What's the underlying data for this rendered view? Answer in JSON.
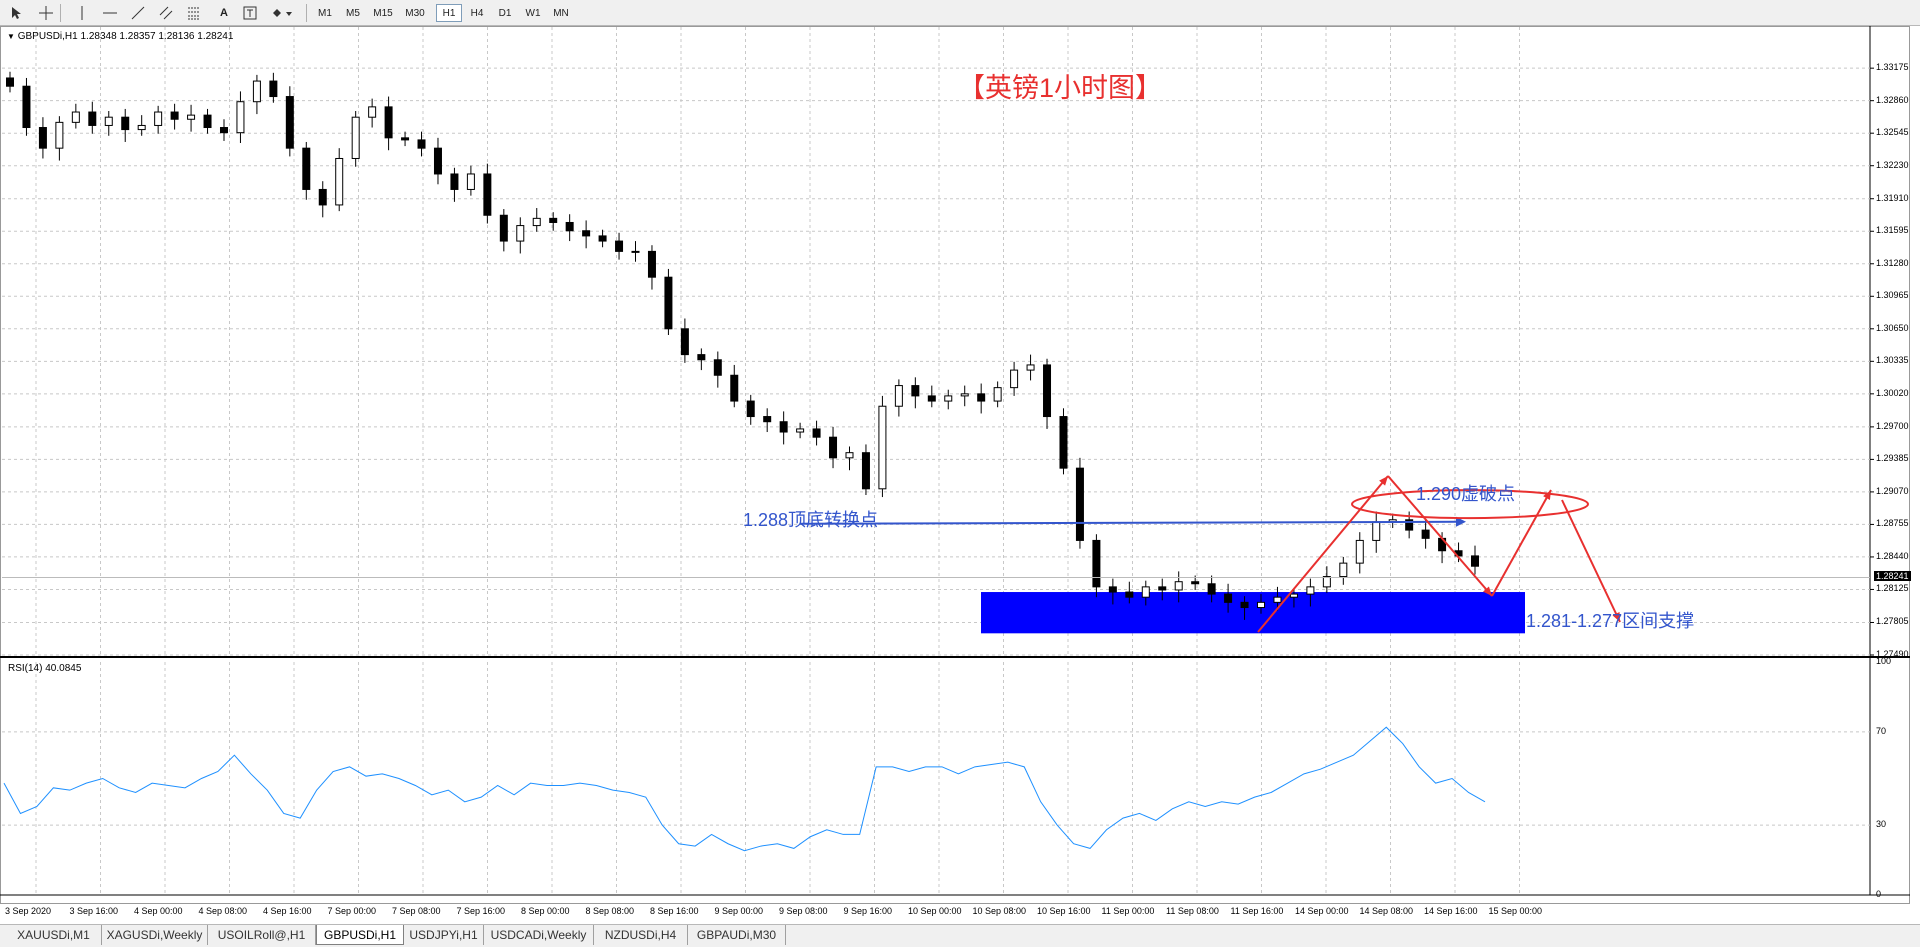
{
  "toolbar": {
    "tools": [
      "cursor-icon",
      "crosshair-icon",
      "vertical-line-icon",
      "horizontal-line-icon",
      "trendline-icon",
      "channel-icon",
      "fibonacci-icon",
      "text-icon",
      "text-label-icon",
      "arrows-icon"
    ],
    "timeframes": [
      "M1",
      "M5",
      "M15",
      "M30",
      "H1",
      "H4",
      "D1",
      "W1",
      "MN"
    ],
    "active_timeframe": "H1"
  },
  "chart": {
    "header": "GBPUSDi,H1  1.28348 1.28357 1.28136 1.28241",
    "current_price": "1.28241",
    "title_annotation": "【英镑1小时图】",
    "annotation_top_bottom": "1.288顶底转换点",
    "annotation_false_break": "1.290虚破点",
    "annotation_support": "1.281-1.277区间支撑",
    "price_ticks": [
      "1.33175",
      "1.32860",
      "1.32545",
      "1.32230",
      "1.31910",
      "1.31595",
      "1.31280",
      "1.30965",
      "1.30650",
      "1.30335",
      "1.30020",
      "1.29700",
      "1.29385",
      "1.29070",
      "1.28755",
      "1.28440",
      "1.28125",
      "1.27805",
      "1.27490"
    ],
    "time_ticks": [
      "3 Sep 2020",
      "3 Sep 16:00",
      "4 Sep 00:00",
      "4 Sep 08:00",
      "4 Sep 16:00",
      "7 Sep 00:00",
      "7 Sep 08:00",
      "7 Sep 16:00",
      "8 Sep 00:00",
      "8 Sep 08:00",
      "8 Sep 16:00",
      "9 Sep 00:00",
      "9 Sep 08:00",
      "9 Sep 16:00",
      "10 Sep 00:00",
      "10 Sep 08:00",
      "10 Sep 16:00",
      "11 Sep 00:00",
      "11 Sep 08:00",
      "11 Sep 16:00",
      "14 Sep 00:00",
      "14 Sep 08:00",
      "14 Sep 16:00",
      "15 Sep 00:00"
    ],
    "colors": {
      "bull": "#ffffff",
      "bear": "#000000",
      "support_zone": "#0000ff",
      "annotation_red": "#e8302f",
      "annotation_blue": "#3355cc",
      "rsi_line": "#1e90ff"
    }
  },
  "rsi": {
    "label": "RSI(14) 40.0845",
    "ticks": [
      "100",
      "70",
      "30",
      "0"
    ]
  },
  "tabs": [
    {
      "label": "XAUUSDi,M1",
      "active": false
    },
    {
      "label": "XAGUSDi,Weekly",
      "active": false
    },
    {
      "label": "USOILRoll@,H1",
      "active": false
    },
    {
      "label": "GBPUSDi,H1",
      "active": true
    },
    {
      "label": "USDJPYi,H1",
      "active": false
    },
    {
      "label": "USDCADi,Weekly",
      "active": false
    },
    {
      "label": "NZDUSDi,H4",
      "active": false
    },
    {
      "label": "GBPAUDi,M30",
      "active": false
    }
  ],
  "chart_data": {
    "type": "candlestick",
    "title": "",
    "symbol": "GBPUSDi",
    "timeframe": "H1",
    "ylim": [
      1.2749,
      1.3338
    ],
    "ohlc_close_path": [
      1.33,
      1.326,
      1.324,
      1.3265,
      1.3275,
      1.3262,
      1.327,
      1.3258,
      1.3262,
      1.3275,
      1.3268,
      1.3272,
      1.326,
      1.3255,
      1.3285,
      1.3305,
      1.329,
      1.324,
      1.32,
      1.3185,
      1.323,
      1.327,
      1.328,
      1.325,
      1.3248,
      1.324,
      1.3215,
      1.32,
      1.3215,
      1.3175,
      1.315,
      1.3165,
      1.3172,
      1.3168,
      1.316,
      1.3155,
      1.315,
      1.314,
      1.314,
      1.3115,
      1.3065,
      1.304,
      1.3035,
      1.302,
      1.2995,
      1.298,
      1.2975,
      1.2965,
      1.2968,
      1.296,
      1.294,
      1.2945,
      1.291,
      1.299,
      1.301,
      1.3,
      1.2995,
      1.3,
      1.3002,
      1.2995,
      1.3008,
      1.3025,
      1.303,
      1.298,
      1.293,
      1.286,
      1.2815,
      1.281,
      1.2805,
      1.2815,
      1.2812,
      1.282,
      1.2818,
      1.2808,
      1.28,
      1.2795,
      1.28,
      1.2805,
      1.2808,
      1.2815,
      1.2825,
      1.2838,
      1.286,
      1.2878,
      1.288,
      1.287,
      1.2862,
      1.285,
      1.2845,
      1.2835
    ],
    "rsi": {
      "name": "RSI(14)",
      "last": 40.0845,
      "ylim": [
        0,
        100
      ],
      "levels": [
        30,
        70
      ]
    },
    "support_zone": [
      1.277,
      1.281
    ],
    "resistance_line": 1.288
  }
}
